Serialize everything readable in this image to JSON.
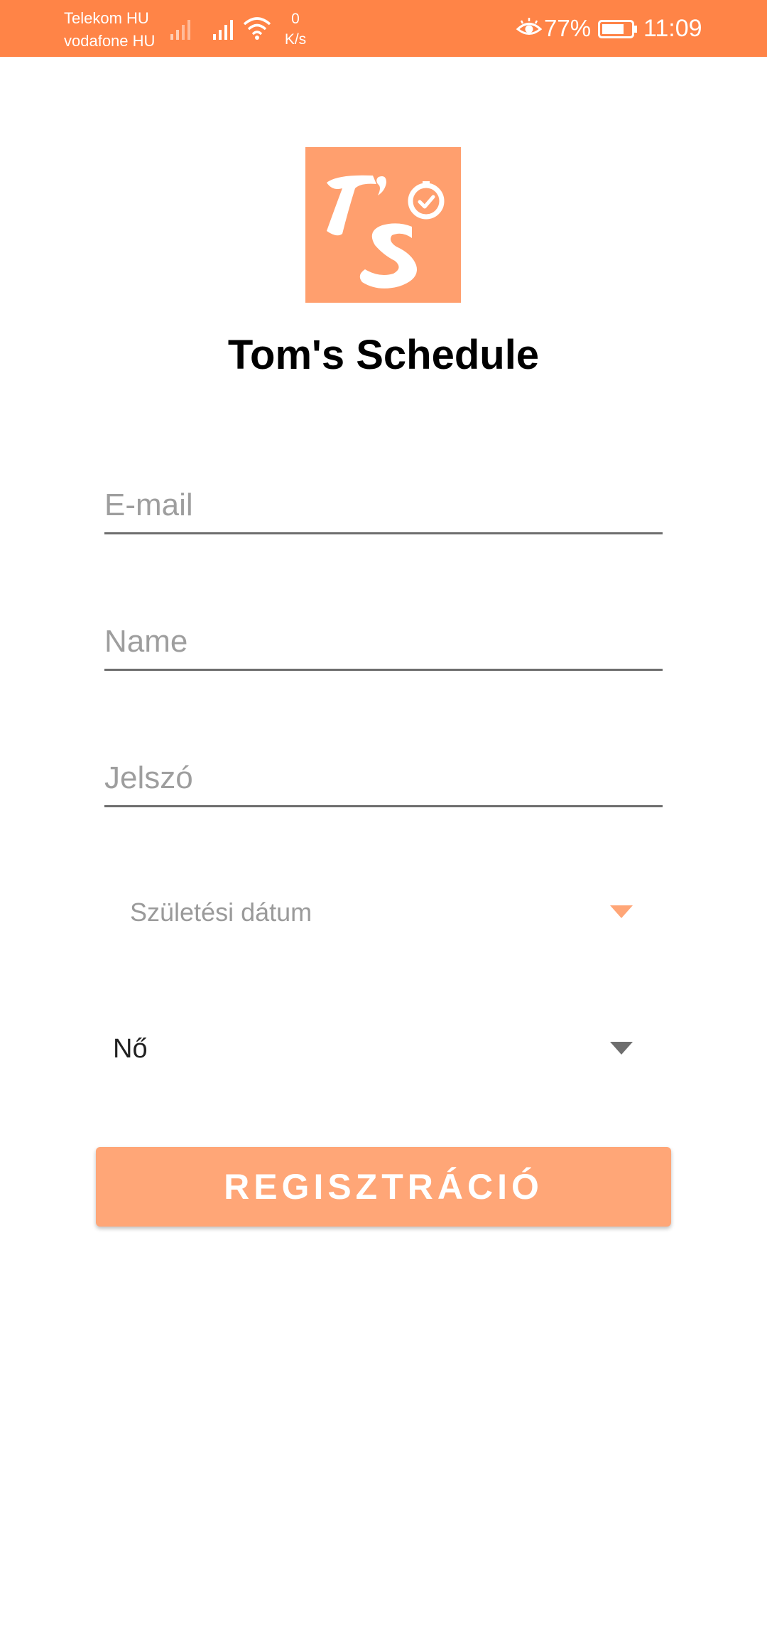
{
  "status_bar": {
    "carrier_1": "Telekom HU",
    "carrier_2": "vodafone HU",
    "net_speed_value": "0",
    "net_speed_unit": "K/s",
    "battery_percent": "77%",
    "time": "11:09",
    "icons": [
      "signal-icon",
      "signal-icon",
      "wifi-icon",
      "eye-icon",
      "battery-icon"
    ]
  },
  "header": {
    "logo_icon": "app-logo",
    "title": "Tom's Schedule"
  },
  "form": {
    "email_placeholder": "E-mail",
    "name_placeholder": "Name",
    "password_placeholder": "Jelszó",
    "birthdate_placeholder": "Születési dátum",
    "gender_selected": "Nő",
    "register_label": "REGISZTRÁCIÓ"
  },
  "colors": {
    "status_bar": "#ff8447",
    "logo_background": "#ff9f6e",
    "button": "#ffa677",
    "date_arrow": "#ffa677",
    "gender_arrow": "#6e6e6e"
  }
}
